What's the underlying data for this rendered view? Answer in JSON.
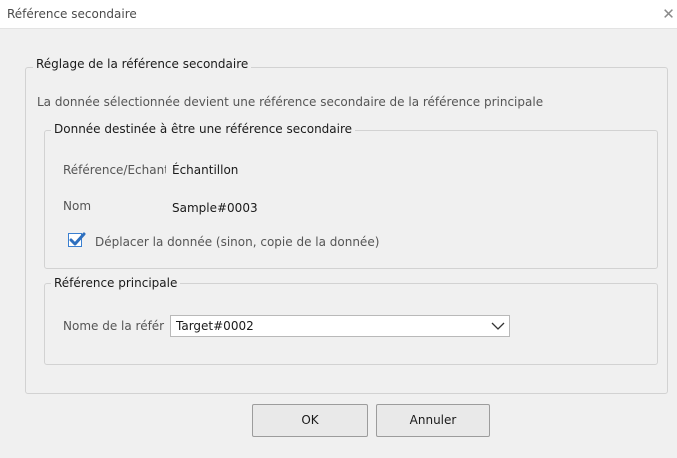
{
  "window": {
    "title": "Référence secondaire",
    "close_label": "✕"
  },
  "settings_group": {
    "legend": "Réglage de la référence secondaire",
    "description": "La donnée sélectionnée devient une référence secondaire de la référence principale"
  },
  "data_group": {
    "legend": "Donnée destinée à être une référence secondaire",
    "reference_label": "Référence/Echant",
    "reference_value": "Échantillon",
    "name_label": "Nom",
    "name_value": "Sample#0003",
    "move_checkbox_label": "Déplacer la donnée (sinon, copie de la donnée)",
    "move_checked": true
  },
  "main_ref_group": {
    "legend": "Référence principale",
    "name_label": "Nome de la référ",
    "selected_value": "Target#0002"
  },
  "buttons": {
    "ok": "OK",
    "cancel": "Annuler"
  },
  "colors": {
    "accent": "#3a7fd0",
    "background": "#f0f0f0"
  }
}
